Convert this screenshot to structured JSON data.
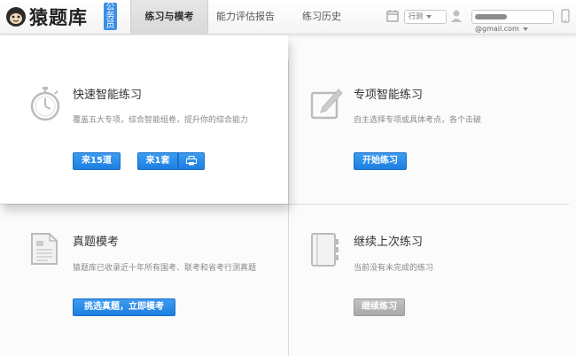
{
  "header": {
    "logo_text": "猿题库",
    "badge": [
      "公",
      "务",
      "员"
    ],
    "nav": [
      {
        "label": "练习与模考",
        "active": true
      },
      {
        "label": "能力评估报告",
        "active": false
      },
      {
        "label": "练习历史",
        "active": false
      }
    ],
    "exam_select": "行测",
    "email_suffix": "@gmail.com"
  },
  "cards": {
    "quick": {
      "title": "快速智能练习",
      "desc": "覆盖五大专项，综合智能组卷，提升你的综合能力",
      "btn15": "来15道",
      "btn_set": "来1套",
      "print_icon": "print-icon"
    },
    "special": {
      "title": "专项智能练习",
      "desc": "自主选择专项或具体考点，各个击破",
      "btn": "开始练习"
    },
    "real": {
      "title": "真题模考",
      "desc": "猿题库已收录近十年所有国考、联考和省考行测真题",
      "btn": "挑选真题，立即模考"
    },
    "continue": {
      "title": "继续上次练习",
      "desc": "当前没有未完成的练习",
      "btn": "继续练习"
    }
  },
  "colors": {
    "primary": "#1d7fe0",
    "badge": "#3a8ee6",
    "disabled": "#a8a8a8"
  }
}
